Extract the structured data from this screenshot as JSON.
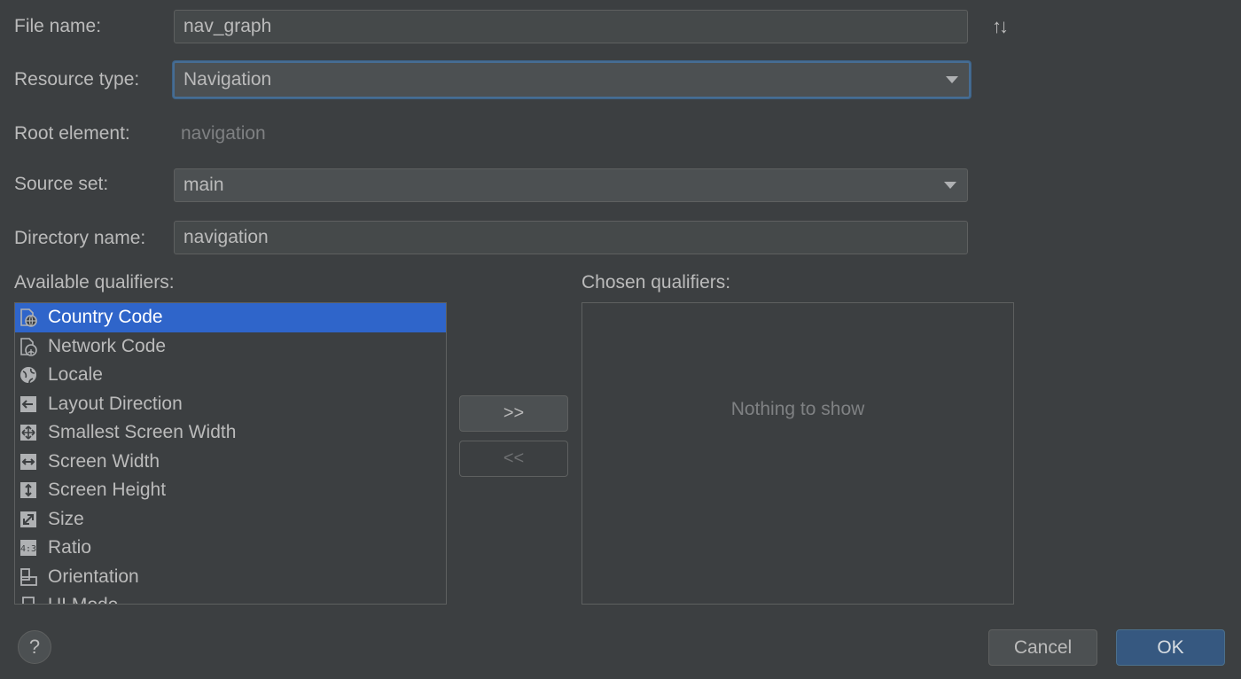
{
  "form": {
    "file_name_label": "File name:",
    "file_name_value": "nav_graph",
    "resource_type_label": "Resource type:",
    "resource_type_value": "Navigation",
    "root_element_label": "Root element:",
    "root_element_value": "navigation",
    "source_set_label": "Source set:",
    "source_set_value": "main",
    "directory_name_label": "Directory name:",
    "directory_name_value": "navigation",
    "sort_icon": "sort-arrows-icon",
    "sort_glyph": "↑↓"
  },
  "qualifiers": {
    "available_label": "Available qualifiers:",
    "chosen_label": "Chosen qualifiers:",
    "chosen_empty_text": "Nothing to show",
    "add_button": ">>",
    "remove_button": "<<",
    "items": [
      {
        "label": "Country Code",
        "icon": "country-code-icon",
        "selected": true
      },
      {
        "label": "Network Code",
        "icon": "network-code-icon",
        "selected": false
      },
      {
        "label": "Locale",
        "icon": "globe-icon",
        "selected": false
      },
      {
        "label": "Layout Direction",
        "icon": "layout-direction-icon",
        "selected": false
      },
      {
        "label": "Smallest Screen Width",
        "icon": "smallest-width-icon",
        "selected": false
      },
      {
        "label": "Screen Width",
        "icon": "screen-width-icon",
        "selected": false
      },
      {
        "label": "Screen Height",
        "icon": "screen-height-icon",
        "selected": false
      },
      {
        "label": "Size",
        "icon": "size-icon",
        "selected": false
      },
      {
        "label": "Ratio",
        "icon": "ratio-icon",
        "selected": false
      },
      {
        "label": "Orientation",
        "icon": "orientation-icon",
        "selected": false
      },
      {
        "label": "UI Mode",
        "icon": "ui-mode-icon",
        "selected": false
      }
    ]
  },
  "footer": {
    "help_glyph": "?",
    "cancel_label": "Cancel",
    "ok_label": "OK"
  },
  "colors": {
    "background": "#3c3f41",
    "selection": "#2f65ca",
    "ok_button": "#365880",
    "focus_border": "#466d94"
  }
}
